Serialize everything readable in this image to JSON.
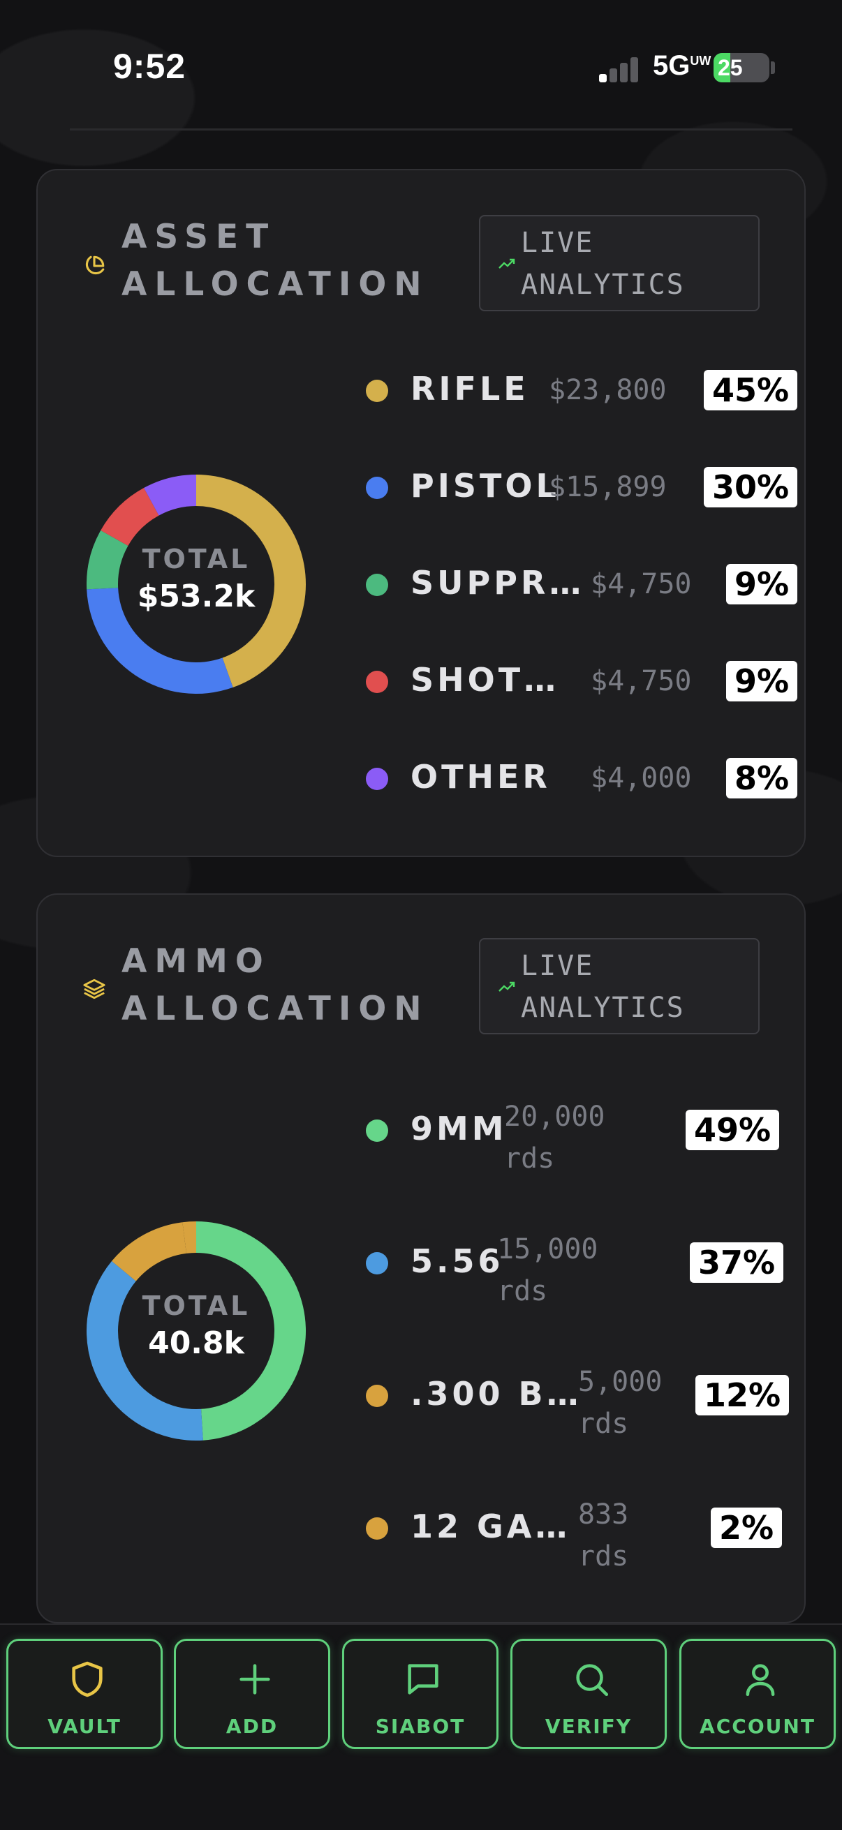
{
  "status_bar": {
    "time": "9:52",
    "network": "5G",
    "network_suffix": "UW",
    "battery": "25"
  },
  "asset_allocation": {
    "title": "ASSET ALLOCATION",
    "badge": "LIVE ANALYTICS",
    "total_label": "TOTAL",
    "total_value": "$53.2k",
    "items": [
      {
        "name": "RIFLE",
        "value": "$23,800",
        "percent": "45%",
        "color": "#d4b04c"
      },
      {
        "name": "PISTOL",
        "value": "$15,899",
        "percent": "30%",
        "color": "#4a7df0"
      },
      {
        "name": "SUPPR…",
        "value": "$4,750",
        "percent": "9%",
        "color": "#4cba7f"
      },
      {
        "name": "SHOT…",
        "value": "$4,750",
        "percent": "9%",
        "color": "#e14f4f"
      },
      {
        "name": "OTHER",
        "value": "$4,000",
        "percent": "8%",
        "color": "#8b5cf6"
      }
    ]
  },
  "ammo_allocation": {
    "title": "AMMO ALLOCATION",
    "badge": "LIVE ANALYTICS",
    "total_label": "TOTAL",
    "total_value": "40.8k",
    "items": [
      {
        "name": "9MM",
        "value": "20,000",
        "unit": "rds",
        "percent": "49%",
        "color": "#66d68a"
      },
      {
        "name": "5.56",
        "value": "15,000",
        "unit": "rds",
        "percent": "37%",
        "color": "#4d9be0"
      },
      {
        "name": ".300 B…",
        "value": "5,000",
        "unit": "rds",
        "percent": "12%",
        "color": "#d8a23e"
      },
      {
        "name": "12 GA…",
        "value": "833",
        "unit": "rds",
        "percent": "2%",
        "color": "#d8a23e"
      }
    ]
  },
  "tabs": [
    {
      "label": "VAULT",
      "icon": "shield-icon",
      "active": true
    },
    {
      "label": "ADD",
      "icon": "plus-icon",
      "active": false
    },
    {
      "label": "SIABOT",
      "icon": "chat-icon",
      "active": false
    },
    {
      "label": "VERIFY",
      "icon": "search-icon",
      "active": false
    },
    {
      "label": "ACCOUNT",
      "icon": "user-icon",
      "active": false
    }
  ],
  "colors": {
    "accent_gold": "#e8c547",
    "accent_green": "#5fd07c",
    "card_bg": "#1e1e20"
  }
}
